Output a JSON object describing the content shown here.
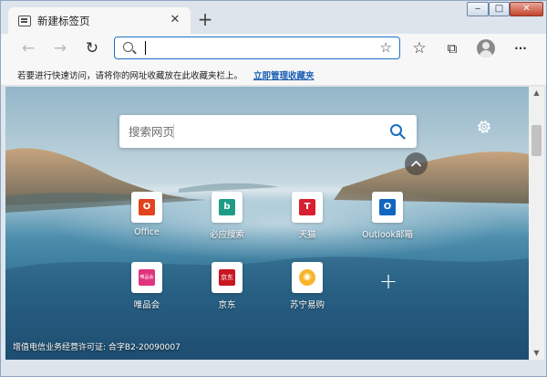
{
  "window": {
    "tab_title": "新建标签页",
    "tab_close": "✕",
    "new_tab": "+",
    "controls": {
      "minimize": "‒",
      "maximize": "□",
      "close": "✕"
    }
  },
  "toolbar": {
    "back_icon": "←",
    "forward_icon": "→",
    "refresh_icon": "↻",
    "address_value": "",
    "add_favorite_icon": "☆",
    "favorites_icon": "☆",
    "collections_icon": "⧉",
    "menu_icon": "···"
  },
  "favorites_bar": {
    "message": "若要进行快速访问，请将你的网址收藏放在此收藏夹栏上。",
    "link": "立即管理收藏夹"
  },
  "new_tab_page": {
    "search_placeholder": "搜索网页",
    "tiles": [
      {
        "label": "Office",
        "icon": "office-icon",
        "glyph": "O",
        "color": "#e2431e"
      },
      {
        "label": "必应搜索",
        "icon": "bing-icon",
        "glyph": "b",
        "color": "#1f9c86"
      },
      {
        "label": "天猫",
        "icon": "tmall-icon",
        "glyph": "T",
        "color": "#d71f2f"
      },
      {
        "label": "Outlook邮箱",
        "icon": "outlook-icon",
        "glyph": "O",
        "color": "#0f66c1"
      },
      {
        "label": "唯品会",
        "icon": "vip-icon",
        "glyph": "唯品会",
        "color": "#e0347f"
      },
      {
        "label": "京东",
        "icon": "jd-icon",
        "glyph": "京东",
        "color": "#c91623"
      },
      {
        "label": "苏宁易购",
        "icon": "suning-icon",
        "glyph": "◉",
        "color": "#f7b52c"
      }
    ],
    "add_tile": "+",
    "license": "增值电信业务经营许可证: 合字B2-20090007"
  }
}
